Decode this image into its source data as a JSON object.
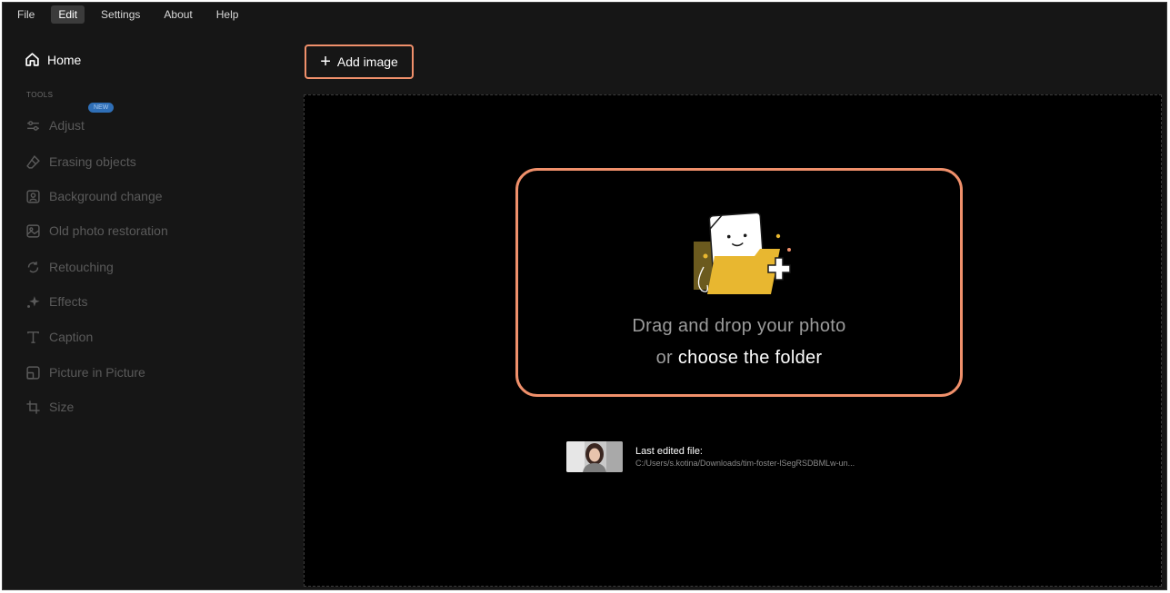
{
  "menu": {
    "items": [
      {
        "label": "File",
        "active": false
      },
      {
        "label": "Edit",
        "active": true
      },
      {
        "label": "Settings",
        "active": false
      },
      {
        "label": "About",
        "active": false
      },
      {
        "label": "Help",
        "active": false
      }
    ]
  },
  "sidebar": {
    "home_label": "Home",
    "section_label": "TOOLS",
    "new_badge": "NEW",
    "tools": [
      {
        "label": "Adjust",
        "icon": "sliders-icon"
      },
      {
        "label": "Erasing objects",
        "icon": "eraser-icon"
      },
      {
        "label": "Background change",
        "icon": "portrait-icon"
      },
      {
        "label": "Old photo restoration",
        "icon": "photo-restore-icon"
      },
      {
        "label": "Retouching",
        "icon": "retouch-icon"
      },
      {
        "label": "Effects",
        "icon": "sparkle-icon"
      },
      {
        "label": "Caption",
        "icon": "text-icon"
      },
      {
        "label": "Picture in Picture",
        "icon": "pip-icon"
      },
      {
        "label": "Size",
        "icon": "crop-icon"
      }
    ]
  },
  "toolbar": {
    "add_image_label": "Add image"
  },
  "dropzone": {
    "line1": "Drag and drop your photo",
    "line2_prefix": "or",
    "line2_link": "choose the folder"
  },
  "last_file": {
    "title": "Last edited file:",
    "path": "C:/Users/s.kotina/Downloads/tim-foster-lSegRSDBMLw-un..."
  },
  "colors": {
    "accent": "#f0906b",
    "background": "#161616",
    "dropzone": "#000000",
    "badge": "#2f6fb7",
    "folder": "#e8b730"
  }
}
